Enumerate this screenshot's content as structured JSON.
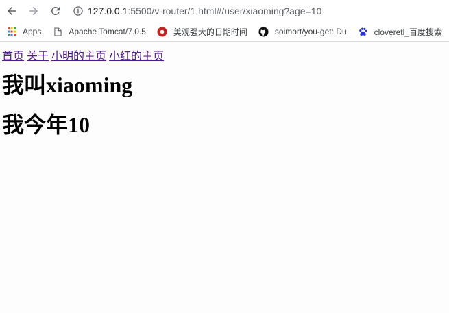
{
  "browser": {
    "url_host": "127.0.0.1",
    "url_rest": ":5500/v-router/1.html#/user/xiaoming?age=10"
  },
  "bookmarks": [
    {
      "label": "Apps",
      "icon": "apps-grid-icon"
    },
    {
      "label": "Apache Tomcat/7.0.5",
      "icon": "page-icon"
    },
    {
      "label": "美观强大的日期时间",
      "icon": "red-circle-icon"
    },
    {
      "label": "soimort/you-get: Du",
      "icon": "github-icon"
    },
    {
      "label": "cloveretl_百度搜索",
      "icon": "baidu-paw-icon"
    }
  ],
  "nav": {
    "home": "首页",
    "about": "关于",
    "xiaoming": "小明的主页",
    "xiaohong": "小红的主页"
  },
  "main": {
    "name_prefix": "我叫",
    "name": "xiaoming",
    "age_prefix": "我今年",
    "age": "10"
  }
}
